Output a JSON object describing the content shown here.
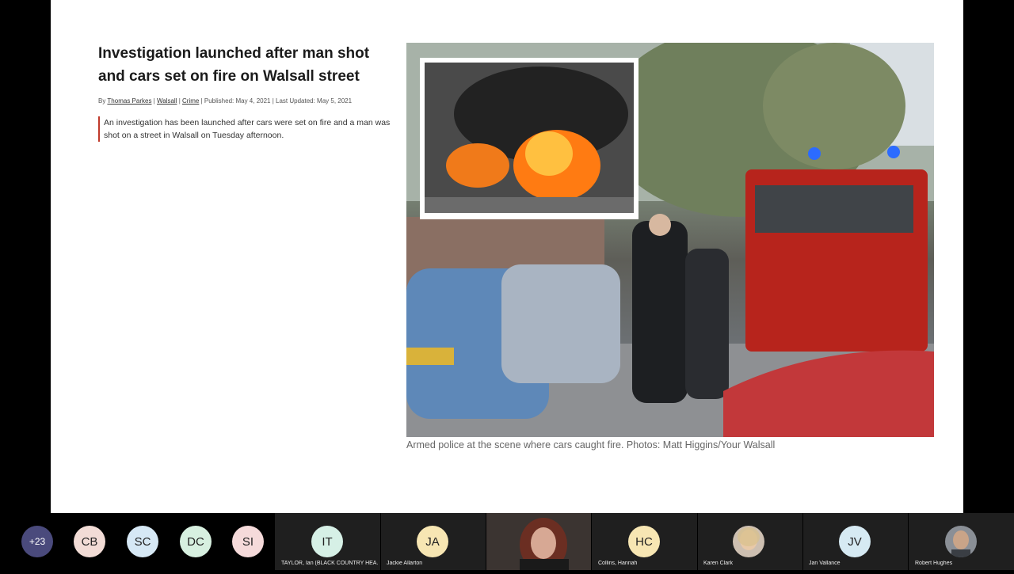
{
  "article": {
    "headline": "Investigation launched after man shot and cars set on fire on Walsall street",
    "byline": {
      "by": "By",
      "author": "Thomas Parkes",
      "section": "Walsall",
      "category": "Crime",
      "published": "Published: May 4, 2021",
      "updated": "Last Updated: May 5, 2021"
    },
    "standfirst": "An investigation has been launched after cars were set on fire and a man was shot on a street in Walsall on Tuesday afternoon.",
    "caption": "Armed police at the scene where cars caught fire. Photos: Matt Higgins/Your Walsall"
  },
  "participants": {
    "overflow": "+23",
    "items": [
      {
        "initials": "CB",
        "name": "",
        "color": "#f2dcd6"
      },
      {
        "initials": "SC",
        "name": "",
        "color": "#d6e8f5"
      },
      {
        "initials": "DC",
        "name": "",
        "color": "#d7f0e0"
      },
      {
        "initials": "SI",
        "name": "",
        "color": "#f5dada"
      },
      {
        "initials": "IT",
        "name": "TAYLOR, Ian (BLACK COUNTRY HEA...",
        "color": "#d6f0e6"
      },
      {
        "initials": "JA",
        "name": "Jackie Allarton",
        "color": "#f7e6b3"
      },
      {
        "initials": "",
        "name": "",
        "color": "#3a3330"
      },
      {
        "initials": "HC",
        "name": "Collins, Hannah",
        "color": "#f7e6b3"
      },
      {
        "initials": "",
        "name": "Karen Clark",
        "color": "#cdbfb1"
      },
      {
        "initials": "JV",
        "name": "Jan Vallance",
        "color": "#d6eaf3"
      },
      {
        "initials": "",
        "name": "Robert Hughes",
        "color": "#8a8f96"
      }
    ],
    "overflow_color": "#4a4a7c"
  }
}
